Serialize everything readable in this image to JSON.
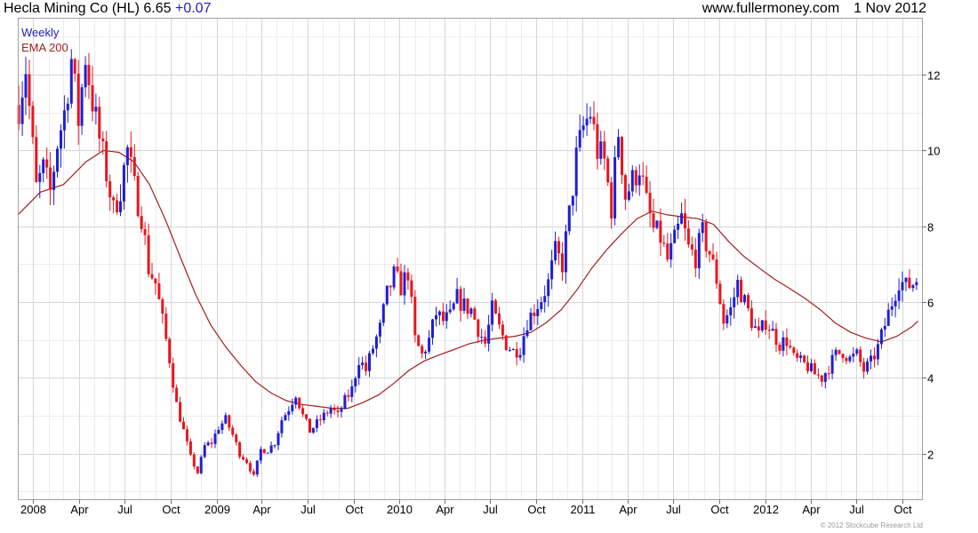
{
  "header": {
    "security": "Hecla Mining Co (HL)",
    "price": "6.65",
    "change": "+0.07",
    "source": "www.fullermoney.com",
    "date": "1 Nov 2012"
  },
  "copyright": "© 2012 Stockcube Research Ltd",
  "colors": {
    "up": "#1f1fd2",
    "down": "#e8161e",
    "ema": "#a02020",
    "grid": "#d6d6d6",
    "frame": "#a0a0a0",
    "weekly_label": "#2020c0",
    "ema_label": "#a02020"
  },
  "chart_data": {
    "type": "candlestick",
    "frequency": "Weekly",
    "legend": [
      "Weekly",
      "EMA 200"
    ],
    "legend_position": "top-left",
    "grid": true,
    "y_axis": {
      "side": "right",
      "range": [
        0.8,
        13.5
      ],
      "ticks": [
        2,
        4,
        6,
        8,
        10,
        12
      ]
    },
    "x_axis": {
      "range": [
        "2007-12-01",
        "2012-11-09"
      ],
      "ticks": [
        {
          "label": "2008",
          "date": "2008-01-01"
        },
        {
          "label": "Apr",
          "date": "2008-04-01"
        },
        {
          "label": "Jul",
          "date": "2008-07-01"
        },
        {
          "label": "Oct",
          "date": "2008-10-01"
        },
        {
          "label": "2009",
          "date": "2009-01-01"
        },
        {
          "label": "Apr",
          "date": "2009-04-01"
        },
        {
          "label": "Jul",
          "date": "2009-07-01"
        },
        {
          "label": "Oct",
          "date": "2009-10-01"
        },
        {
          "label": "2010",
          "date": "2010-01-01"
        },
        {
          "label": "Apr",
          "date": "2010-04-01"
        },
        {
          "label": "Jul",
          "date": "2010-07-01"
        },
        {
          "label": "Oct",
          "date": "2010-10-01"
        },
        {
          "label": "2011",
          "date": "2011-01-01"
        },
        {
          "label": "Apr",
          "date": "2011-04-01"
        },
        {
          "label": "Jul",
          "date": "2011-07-01"
        },
        {
          "label": "Oct",
          "date": "2011-10-01"
        },
        {
          "label": "2012",
          "date": "2012-01-01"
        },
        {
          "label": "Apr",
          "date": "2012-04-01"
        },
        {
          "label": "Jul",
          "date": "2012-07-01"
        },
        {
          "label": "Oct",
          "date": "2012-10-01"
        }
      ]
    },
    "close_path": [
      [
        "2007-12-03",
        11.2
      ],
      [
        "2007-12-17",
        12.2
      ],
      [
        "2008-01-07",
        9.0
      ],
      [
        "2008-01-21",
        9.5
      ],
      [
        "2008-02-04",
        8.9
      ],
      [
        "2008-02-18",
        10.2
      ],
      [
        "2008-03-03",
        11.0
      ],
      [
        "2008-03-17",
        12.4
      ],
      [
        "2008-03-31",
        10.8
      ],
      [
        "2008-04-14",
        12.5
      ],
      [
        "2008-04-28",
        11.3
      ],
      [
        "2008-05-12",
        10.3
      ],
      [
        "2008-05-26",
        9.4
      ],
      [
        "2008-06-09",
        8.4
      ],
      [
        "2008-06-23",
        9.0
      ],
      [
        "2008-07-07",
        10.0
      ],
      [
        "2008-07-21",
        9.0
      ],
      [
        "2008-08-04",
        8.3
      ],
      [
        "2008-08-18",
        6.9
      ],
      [
        "2008-09-01",
        6.5
      ],
      [
        "2008-09-15",
        5.5
      ],
      [
        "2008-09-29",
        4.5
      ],
      [
        "2008-10-13",
        3.3
      ],
      [
        "2008-10-27",
        2.6
      ],
      [
        "2008-11-10",
        1.9
      ],
      [
        "2008-11-24",
        1.5
      ],
      [
        "2008-12-08",
        2.2
      ],
      [
        "2008-12-22",
        2.3
      ],
      [
        "2009-01-05",
        2.7
      ],
      [
        "2009-01-19",
        2.9
      ],
      [
        "2009-02-02",
        2.5
      ],
      [
        "2009-02-16",
        2.0
      ],
      [
        "2009-03-02",
        1.8
      ],
      [
        "2009-03-16",
        1.4
      ],
      [
        "2009-03-30",
        2.1
      ],
      [
        "2009-04-13",
        2.1
      ],
      [
        "2009-04-27",
        2.3
      ],
      [
        "2009-05-11",
        2.9
      ],
      [
        "2009-05-25",
        3.2
      ],
      [
        "2009-06-08",
        3.6
      ],
      [
        "2009-06-22",
        3.0
      ],
      [
        "2009-07-06",
        2.6
      ],
      [
        "2009-07-20",
        2.8
      ],
      [
        "2009-08-03",
        3.0
      ],
      [
        "2009-08-17",
        3.2
      ],
      [
        "2009-08-31",
        3.0
      ],
      [
        "2009-09-14",
        3.4
      ],
      [
        "2009-09-28",
        3.7
      ],
      [
        "2009-10-12",
        4.5
      ],
      [
        "2009-10-26",
        4.2
      ],
      [
        "2009-11-09",
        4.8
      ],
      [
        "2009-11-23",
        5.3
      ],
      [
        "2009-12-07",
        6.2
      ],
      [
        "2009-12-21",
        6.7
      ],
      [
        "2010-01-04",
        6.4
      ],
      [
        "2010-01-18",
        6.8
      ],
      [
        "2010-02-01",
        5.0
      ],
      [
        "2010-02-15",
        4.6
      ],
      [
        "2010-03-01",
        5.0
      ],
      [
        "2010-03-15",
        5.7
      ],
      [
        "2010-03-29",
        5.5
      ],
      [
        "2010-04-12",
        5.6
      ],
      [
        "2010-04-26",
        6.1
      ],
      [
        "2010-05-10",
        5.9
      ],
      [
        "2010-05-24",
        5.8
      ],
      [
        "2010-06-07",
        5.3
      ],
      [
        "2010-06-21",
        4.9
      ],
      [
        "2010-07-05",
        5.8
      ],
      [
        "2010-07-19",
        5.3
      ],
      [
        "2010-08-02",
        4.9
      ],
      [
        "2010-08-16",
        4.7
      ],
      [
        "2010-08-30",
        4.8
      ],
      [
        "2010-09-13",
        5.5
      ],
      [
        "2010-09-27",
        5.8
      ],
      [
        "2010-10-11",
        6.1
      ],
      [
        "2010-10-25",
        6.5
      ],
      [
        "2010-11-08",
        7.3
      ],
      [
        "2010-11-22",
        7.0
      ],
      [
        "2010-12-06",
        8.3
      ],
      [
        "2010-12-20",
        9.8
      ],
      [
        "2011-01-03",
        10.6
      ],
      [
        "2011-01-17",
        11.0
      ],
      [
        "2011-01-31",
        10.0
      ],
      [
        "2011-02-14",
        9.7
      ],
      [
        "2011-02-28",
        8.5
      ],
      [
        "2011-03-14",
        10.5
      ],
      [
        "2011-03-28",
        8.8
      ],
      [
        "2011-04-11",
        9.2
      ],
      [
        "2011-04-25",
        9.6
      ],
      [
        "2011-05-09",
        8.6
      ],
      [
        "2011-05-23",
        7.9
      ],
      [
        "2011-06-06",
        7.7
      ],
      [
        "2011-06-20",
        7.1
      ],
      [
        "2011-07-04",
        7.6
      ],
      [
        "2011-07-18",
        8.2
      ],
      [
        "2011-08-01",
        7.4
      ],
      [
        "2011-08-15",
        7.2
      ],
      [
        "2011-08-29",
        7.8
      ],
      [
        "2011-09-12",
        7.3
      ],
      [
        "2011-09-26",
        6.6
      ],
      [
        "2011-10-10",
        5.5
      ],
      [
        "2011-10-24",
        5.8
      ],
      [
        "2011-11-07",
        6.5
      ],
      [
        "2011-11-21",
        6.0
      ],
      [
        "2011-12-05",
        5.5
      ],
      [
        "2011-12-19",
        5.1
      ],
      [
        "2012-01-02",
        5.5
      ],
      [
        "2012-01-16",
        5.2
      ],
      [
        "2012-01-30",
        4.9
      ],
      [
        "2012-02-13",
        5.0
      ],
      [
        "2012-02-27",
        4.5
      ],
      [
        "2012-03-12",
        4.4
      ],
      [
        "2012-03-26",
        4.3
      ],
      [
        "2012-04-09",
        4.1
      ],
      [
        "2012-04-23",
        4.0
      ],
      [
        "2012-05-07",
        4.3
      ],
      [
        "2012-05-21",
        4.6
      ],
      [
        "2012-06-04",
        4.7
      ],
      [
        "2012-06-18",
        4.5
      ],
      [
        "2012-07-02",
        4.6
      ],
      [
        "2012-07-16",
        4.2
      ],
      [
        "2012-07-30",
        4.4
      ],
      [
        "2012-08-13",
        4.8
      ],
      [
        "2012-08-27",
        5.4
      ],
      [
        "2012-09-10",
        6.0
      ],
      [
        "2012-09-24",
        6.6
      ],
      [
        "2012-10-08",
        6.4
      ],
      [
        "2012-10-22",
        6.5
      ],
      [
        "2012-11-01",
        6.65
      ]
    ],
    "ema_200": [
      [
        "2007-12-01",
        8.3
      ],
      [
        "2008-01-15",
        8.9
      ],
      [
        "2008-03-01",
        9.1
      ],
      [
        "2008-04-15",
        9.7
      ],
      [
        "2008-05-20",
        10.0
      ],
      [
        "2008-06-20",
        9.95
      ],
      [
        "2008-07-20",
        9.7
      ],
      [
        "2008-08-20",
        9.1
      ],
      [
        "2008-09-20",
        8.2
      ],
      [
        "2008-10-20",
        7.2
      ],
      [
        "2008-11-20",
        6.2
      ],
      [
        "2008-12-20",
        5.4
      ],
      [
        "2009-01-20",
        4.8
      ],
      [
        "2009-02-20",
        4.3
      ],
      [
        "2009-03-20",
        3.9
      ],
      [
        "2009-04-20",
        3.6
      ],
      [
        "2009-05-20",
        3.4
      ],
      [
        "2009-06-20",
        3.3
      ],
      [
        "2009-07-20",
        3.25
      ],
      [
        "2009-08-20",
        3.2
      ],
      [
        "2009-09-20",
        3.2
      ],
      [
        "2009-10-20",
        3.35
      ],
      [
        "2009-11-20",
        3.55
      ],
      [
        "2009-12-20",
        3.85
      ],
      [
        "2010-01-20",
        4.2
      ],
      [
        "2010-02-20",
        4.45
      ],
      [
        "2010-03-20",
        4.6
      ],
      [
        "2010-04-20",
        4.75
      ],
      [
        "2010-05-20",
        4.9
      ],
      [
        "2010-06-20",
        5.0
      ],
      [
        "2010-07-20",
        5.05
      ],
      [
        "2010-08-20",
        5.1
      ],
      [
        "2010-09-20",
        5.2
      ],
      [
        "2010-10-20",
        5.45
      ],
      [
        "2010-11-20",
        5.8
      ],
      [
        "2010-12-20",
        6.3
      ],
      [
        "2011-01-20",
        6.9
      ],
      [
        "2011-02-20",
        7.4
      ],
      [
        "2011-03-20",
        7.8
      ],
      [
        "2011-04-20",
        8.2
      ],
      [
        "2011-05-20",
        8.4
      ],
      [
        "2011-06-20",
        8.3
      ],
      [
        "2011-07-20",
        8.25
      ],
      [
        "2011-08-20",
        8.2
      ],
      [
        "2011-09-20",
        8.05
      ],
      [
        "2011-10-20",
        7.6
      ],
      [
        "2011-11-20",
        7.2
      ],
      [
        "2011-12-20",
        6.9
      ],
      [
        "2012-01-20",
        6.6
      ],
      [
        "2012-02-20",
        6.35
      ],
      [
        "2012-03-20",
        6.1
      ],
      [
        "2012-04-20",
        5.8
      ],
      [
        "2012-05-20",
        5.45
      ],
      [
        "2012-06-20",
        5.2
      ],
      [
        "2012-07-20",
        5.05
      ],
      [
        "2012-08-20",
        4.95
      ],
      [
        "2012-09-20",
        5.1
      ],
      [
        "2012-10-20",
        5.35
      ],
      [
        "2012-11-01",
        5.5
      ]
    ]
  }
}
